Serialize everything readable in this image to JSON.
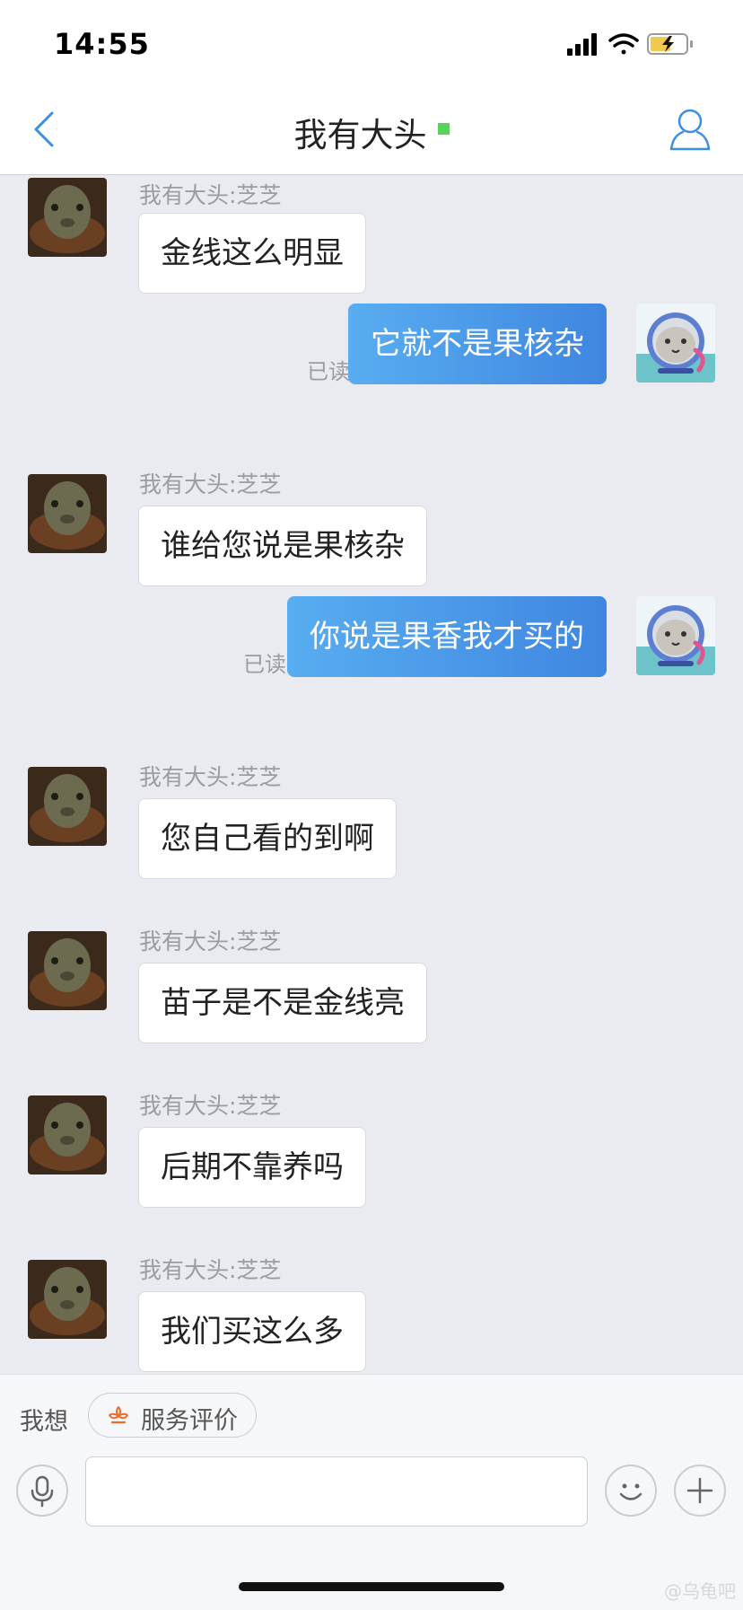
{
  "status_bar": {
    "time": "14:55"
  },
  "nav": {
    "title": "我有大头"
  },
  "messages": [
    {
      "dir": "in",
      "sender": "我有大头:芝芝",
      "text": "金线这么明显"
    },
    {
      "dir": "out",
      "text": "它就不是果核杂",
      "status": "已读"
    },
    {
      "dir": "in",
      "sender": "我有大头:芝芝",
      "text": "谁给您说是果核杂"
    },
    {
      "dir": "out",
      "text": "你说是果香我才买的",
      "status": "已读"
    },
    {
      "dir": "in",
      "sender": "我有大头:芝芝",
      "text": "您自己看的到啊"
    },
    {
      "dir": "in",
      "sender": "我有大头:芝芝",
      "text": "苗子是不是金线亮"
    },
    {
      "dir": "in",
      "sender": "我有大头:芝芝",
      "text": "后期不靠养吗"
    },
    {
      "dir": "in",
      "sender": "我有大头:芝芝",
      "text": "我们买这么多"
    }
  ],
  "bottom": {
    "want_label": "我想",
    "service_label": "服务评价",
    "input_value": ""
  },
  "watermark": "@乌龟吧",
  "colors": {
    "accent": "#4a90e2",
    "online": "#5bd15b",
    "bubble_out": "#4a97e8"
  }
}
